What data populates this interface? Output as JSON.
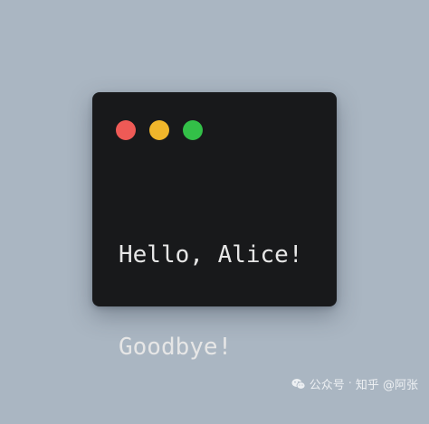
{
  "window": {
    "traffic_lights": {
      "close_color": "#ee5a56",
      "minimize_color": "#f0b62b",
      "maximize_color": "#33c048"
    },
    "background_color": "#18191b"
  },
  "terminal": {
    "lines": [
      "Hello, Alice!",
      "Goodbye!"
    ],
    "text_color": "#e6e6e6"
  },
  "watermark": {
    "icon": "wechat-icon",
    "account_label": "公众号",
    "separator": "·",
    "source_label": "知乎 @阿张"
  }
}
